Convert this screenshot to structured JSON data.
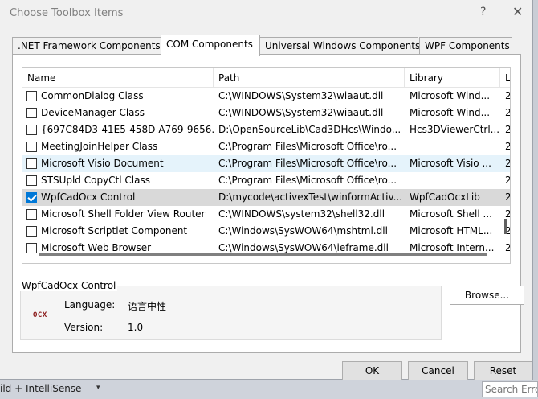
{
  "window": {
    "title": "Choose Toolbox Items",
    "help": "?",
    "close": "✕"
  },
  "tabs": [
    {
      "label": ".NET Framework Components"
    },
    {
      "label": "COM Components"
    },
    {
      "label": "Universal Windows Components"
    },
    {
      "label": "WPF Components"
    }
  ],
  "columns": [
    "Name",
    "Path",
    "Library",
    "L"
  ],
  "rows": [
    {
      "checked": false,
      "name": "CommonDialog Class",
      "path": "C:\\WINDOWS\\System32\\wiaaut.dll",
      "library": "Microsoft Wind...",
      "l": "2"
    },
    {
      "checked": false,
      "name": "DeviceManager Class",
      "path": "C:\\WINDOWS\\System32\\wiaaut.dll",
      "library": "Microsoft Wind...",
      "l": "2"
    },
    {
      "checked": false,
      "name": "{697C84D3-41E5-458D-A769-9656...",
      "path": "D:\\OpenSourceLib\\Cad3DHcs\\Windo...",
      "library": "Hcs3DViewerCtrl...",
      "l": "2"
    },
    {
      "checked": false,
      "name": "MeetingJoinHelper Class",
      "path": "C:\\Program Files\\Microsoft Office\\ro...",
      "library": "",
      "l": "2"
    },
    {
      "checked": false,
      "name": "Microsoft Visio Document",
      "path": "C:\\Program Files\\Microsoft Office\\ro...",
      "library": "Microsoft Visio ...",
      "l": "2"
    },
    {
      "checked": false,
      "name": "STSUpld CopyCtl Class",
      "path": "C:\\Program Files\\Microsoft Office\\ro...",
      "library": "",
      "l": "2"
    },
    {
      "checked": true,
      "name": "WpfCadOcx Control",
      "path": "D:\\mycode\\activexTest\\winformActiv...",
      "library": "WpfCadOcxLib",
      "l": "2"
    },
    {
      "checked": false,
      "name": "Microsoft Shell Folder View Router",
      "path": "C:\\WINDOWS\\system32\\shell32.dll",
      "library": "Microsoft Shell ...",
      "l": "2"
    },
    {
      "checked": false,
      "name": "Microsoft Scriptlet Component",
      "path": "C:\\Windows\\SysWOW64\\mshtml.dll",
      "library": "Microsoft HTML...",
      "l": "2"
    },
    {
      "checked": false,
      "name": "Microsoft Web Browser",
      "path": "C:\\Windows\\SysWOW64\\ieframe.dll",
      "library": "Microsoft Intern...",
      "l": "2"
    }
  ],
  "details": {
    "group_title": "WpfCadOcx Control",
    "icon_text": "OCX",
    "language_label": "Language:",
    "language_value": "语言中性",
    "version_label": "Version:",
    "version_value": "1.0"
  },
  "buttons": {
    "browse": "Browse...",
    "ok": "OK",
    "cancel": "Cancel",
    "reset": "Reset"
  },
  "background": {
    "left_text": "ild + IntelliSense",
    "dropdown": "▾",
    "search": "Search Erro"
  }
}
